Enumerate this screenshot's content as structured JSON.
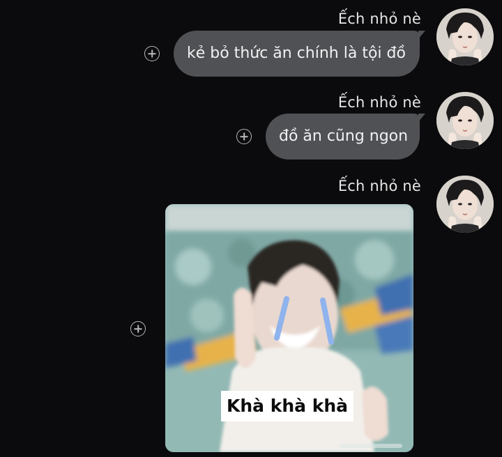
{
  "conversation": {
    "messages": [
      {
        "sender": "Ếch nhỏ nè",
        "text": "kẻ bỏ thức ăn chính là tội đồ"
      },
      {
        "sender": "Ếch nhỏ nè",
        "text": "đồ ăn cũng ngon"
      },
      {
        "sender": "Ếch nhỏ nè",
        "sticker_caption": "Khà khà khà"
      }
    ]
  },
  "icons": {
    "add_reaction": "plus-circle-icon"
  },
  "colors": {
    "background": "#0b0b0d",
    "bubble": "#505155",
    "text": "#f1f1f2",
    "icon": "#b9b9bb"
  }
}
